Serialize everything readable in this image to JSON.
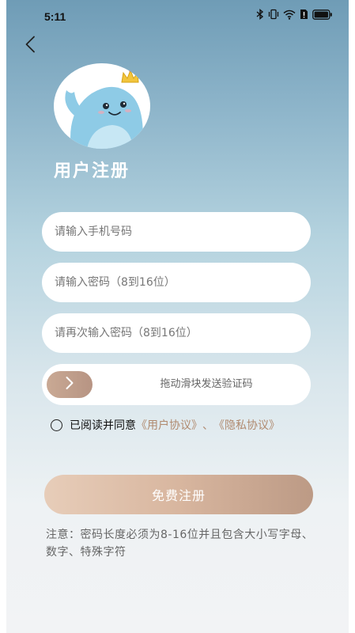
{
  "status_bar": {
    "time": "5:11",
    "icons": [
      "bluetooth-icon",
      "vibrate-icon",
      "wifi-icon",
      "sim-alert-icon",
      "battery-icon"
    ]
  },
  "header": {
    "back_icon": "chevron-left-icon"
  },
  "page": {
    "title": "用户注册"
  },
  "form": {
    "phone_placeholder": "请输入手机号码",
    "password_placeholder": "请输入密码（8到16位）",
    "confirm_password_placeholder": "请再次输入密码（8到16位）",
    "slider_text": "拖动滑块发送验证码",
    "slider_icon": "chevron-right-icon"
  },
  "agreement": {
    "prefix": "已阅读并同意",
    "user_agreement": "《用户协议》",
    "separator": "、",
    "privacy_policy": "《隐私协议》"
  },
  "register_button": {
    "label": "免费注册"
  },
  "notice": {
    "text": "注意：密码长度必须为8-16位并且包含大小写字母、数字、特殊字符"
  },
  "colors": {
    "accent": "#b08a6f",
    "button_gradient_start": "#e7cdb9",
    "button_gradient_end": "#bc9a85",
    "title": "#ffffff"
  }
}
